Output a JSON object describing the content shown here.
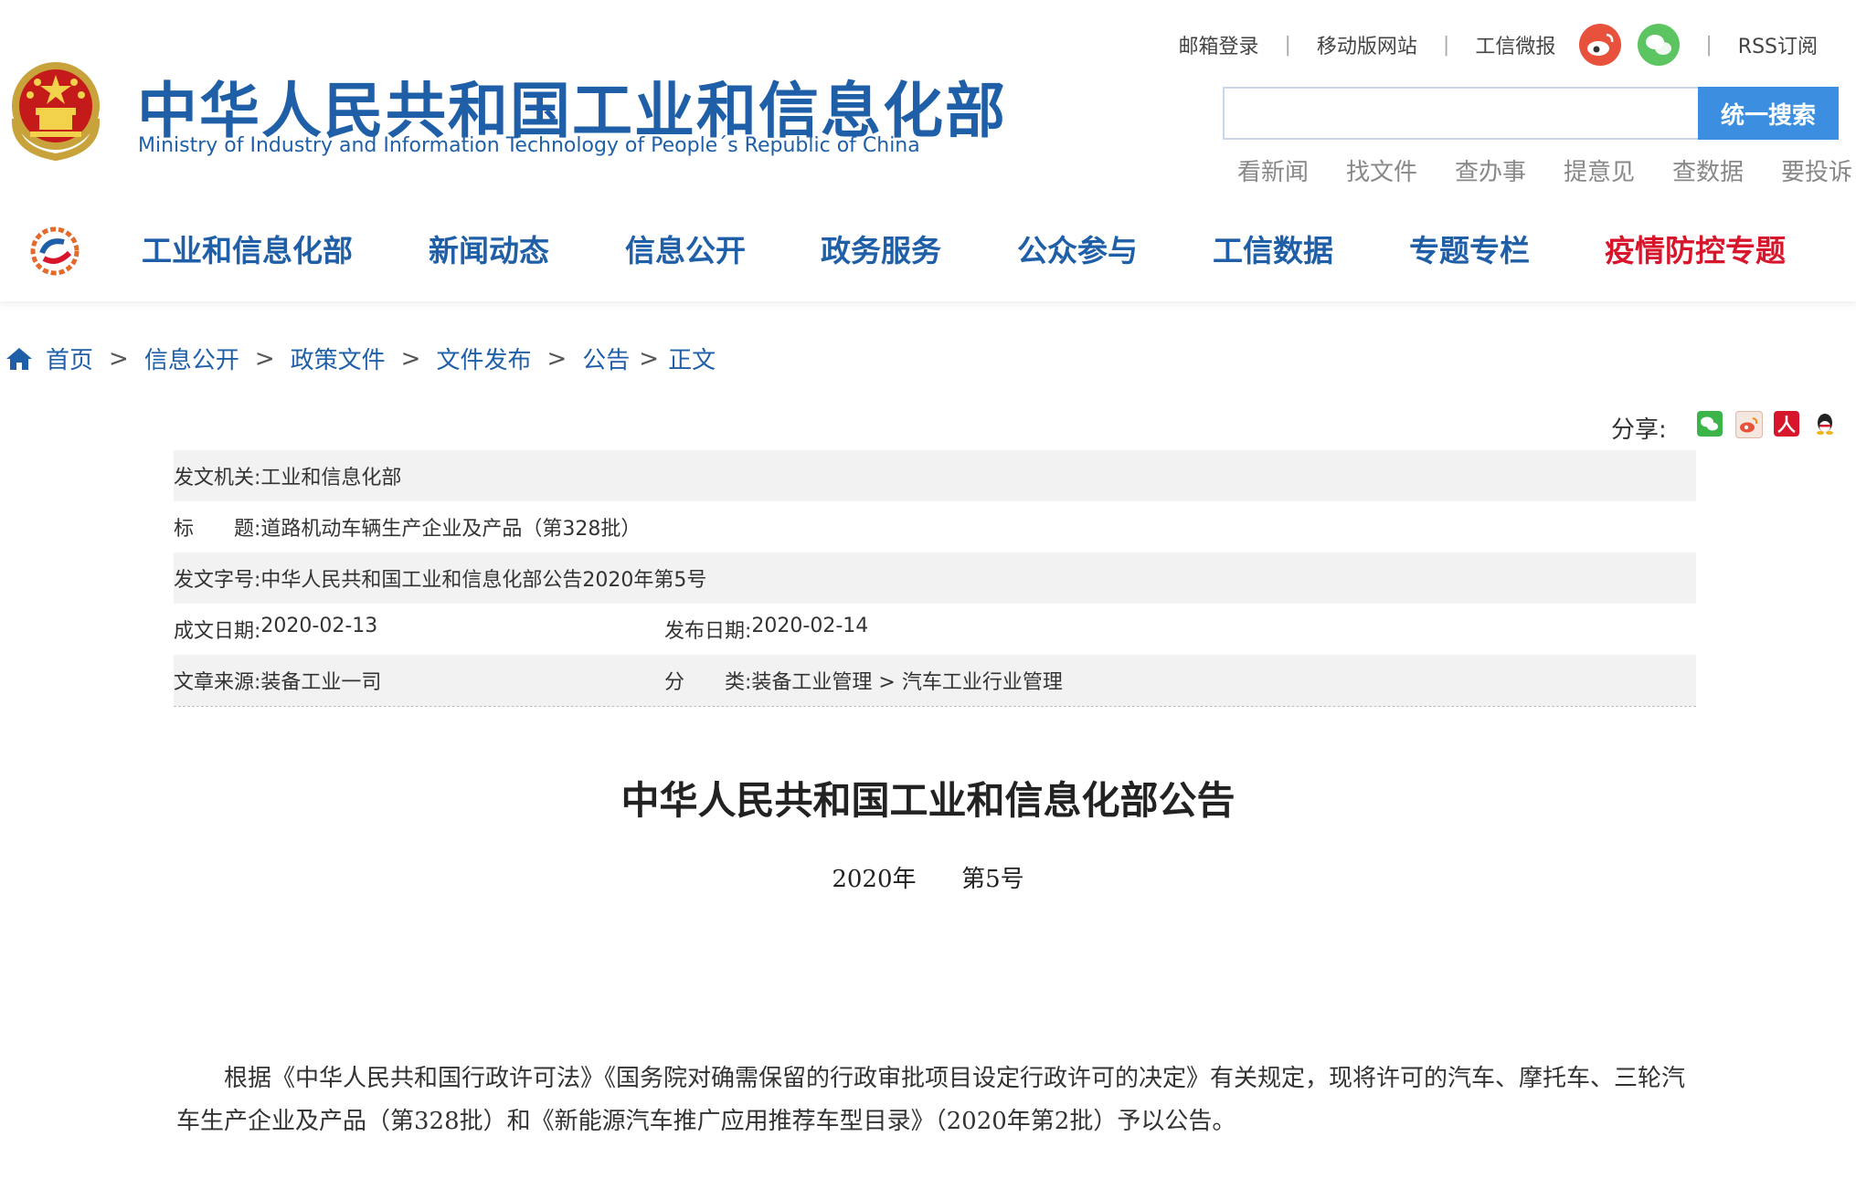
{
  "header": {
    "title": "中华人民共和国工业和信息化部",
    "subtitle": "Ministry of Industry and Information Technology of People´s Republic of China",
    "top_links": [
      "邮箱登录",
      "移动版网站",
      "工信微报",
      "RSS订阅"
    ],
    "search_button": "统一搜索",
    "search_placeholder": "",
    "quick_links": [
      "看新闻",
      "找文件",
      "查办事",
      "提意见",
      "查数据",
      "要投诉"
    ]
  },
  "nav": {
    "items": [
      "工业和信息化部",
      "新闻动态",
      "信息公开",
      "政务服务",
      "公众参与",
      "工信数据",
      "专题专栏",
      "疫情防控专题"
    ]
  },
  "breadcrumb": {
    "items": [
      "首页",
      "信息公开",
      "政策文件",
      "文件发布",
      "公告",
      "正文"
    ],
    "separator": ">"
  },
  "share": {
    "label": "分享:",
    "icons": [
      "wechat-icon",
      "weibo-icon",
      "renren-icon",
      "qq-icon"
    ]
  },
  "meta": {
    "issuer_label": "发文机关:",
    "issuer": "工业和信息化部",
    "title_label": "标　　题:",
    "title": "道路机动车辆生产企业及产品（第328批）",
    "doc_no_label": "发文字号:",
    "doc_no": "中华人民共和国工业和信息化部公告2020年第5号",
    "created_label": "成文日期:",
    "created": "2020-02-13",
    "published_label": "发布日期:",
    "published": "2020-02-14",
    "source_label": "文章来源:",
    "source": "装备工业一司",
    "category_label": "分　　类:",
    "category": "装备工业管理 > 汽车工业行业管理"
  },
  "document": {
    "heading": "中华人民共和国工业和信息化部公告",
    "number": "2020年      第5号",
    "paragraph": "根据《中华人民共和国行政许可法》《国务院对确需保留的行政审批项目设定行政许可的决定》有关规定，现将许可的汽车、摩托车、三轮汽车生产企业及产品（第328批）和《新能源汽车推广应用推荐车型目录》（2020年第2批）予以公告。"
  },
  "colors": {
    "brand_blue": "#1f5fa8",
    "search_blue": "#3c8fe0",
    "alert_red": "#d7162c"
  }
}
